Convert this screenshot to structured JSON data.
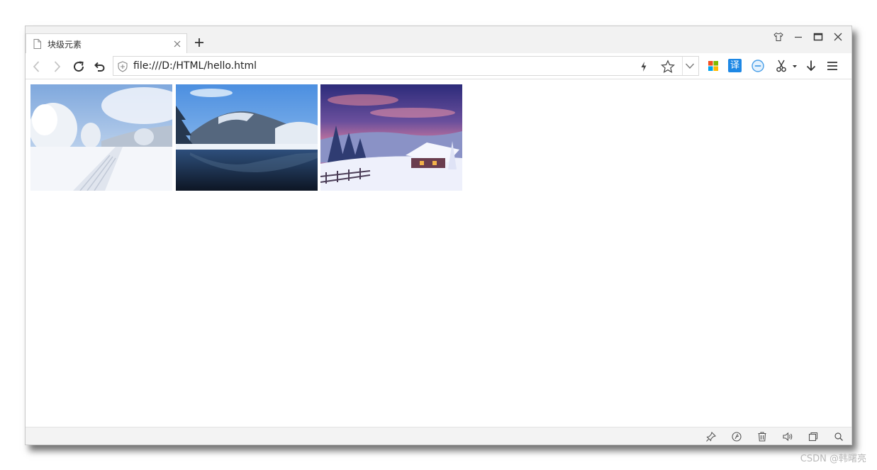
{
  "tab": {
    "title": "块级元素",
    "page_icon": "page-icon",
    "close_icon": "close-icon"
  },
  "new_tab_icon": "plus-icon",
  "window_controls": [
    "skin-icon",
    "minimize-icon",
    "maximize-icon",
    "close-icon"
  ],
  "toolbar": {
    "back_icon": "chevron-left-icon",
    "forward_icon": "chevron-right-icon",
    "reload_icon": "reload-icon",
    "undo_icon": "undo-icon",
    "url": "file:///D:/HTML/hello.html",
    "translate_label": "译",
    "extensions": [
      "apps-grid-icon",
      "translate-icon",
      "adblock-icon",
      "scissors-icon",
      "download-icon",
      "menu-icon"
    ]
  },
  "content": {
    "photos": [
      {
        "name": "snow-field-trees"
      },
      {
        "name": "winter-lake-mountain"
      },
      {
        "name": "snowy-cabin-sunset"
      }
    ]
  },
  "statusbar": {
    "icons": [
      "pin-icon",
      "speed-icon",
      "trash-icon",
      "speaker-icon",
      "window-icon",
      "search-icon"
    ]
  },
  "watermark": "CSDN @韩曙亮",
  "colors": {
    "chrome_bg": "#f2f2f2",
    "accent_blue": "#1e88e5"
  }
}
